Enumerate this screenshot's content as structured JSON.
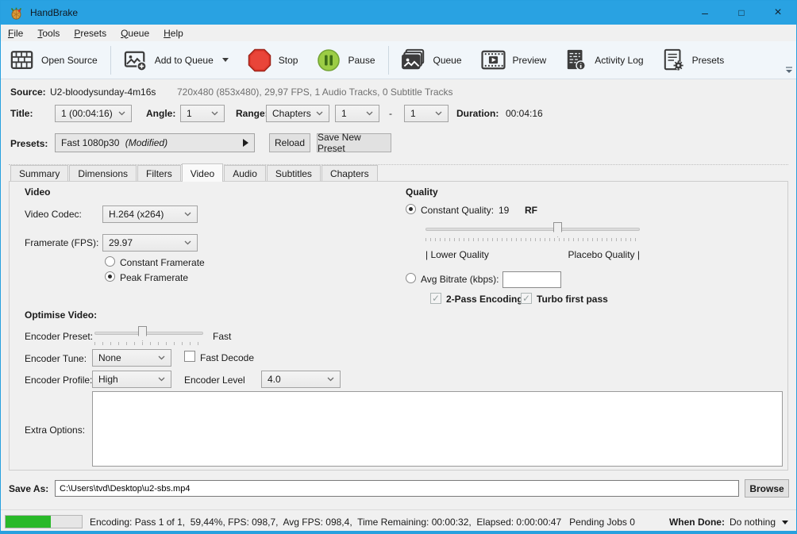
{
  "window": {
    "title": "HandBrake",
    "controls": {
      "minimize": "–",
      "maximize": "□",
      "close": "×"
    }
  },
  "menu": {
    "items": [
      {
        "label": "File"
      },
      {
        "label": "Tools"
      },
      {
        "label": "Presets"
      },
      {
        "label": "Queue"
      },
      {
        "label": "Help"
      }
    ]
  },
  "toolbar": {
    "open_source": "Open Source",
    "add_to_queue": "Add to Queue",
    "stop": "Stop",
    "pause": "Pause",
    "queue": "Queue",
    "preview": "Preview",
    "activity_log": "Activity Log",
    "presets": "Presets"
  },
  "source": {
    "label": "Source:",
    "filename": "U2-bloodysunday-4m16s",
    "details": "720x480 (853x480), 29,97 FPS, 1 Audio Tracks, 0 Subtitle Tracks"
  },
  "title_row": {
    "title_label": "Title:",
    "title_value": "1 (00:04:16)",
    "angle_label": "Angle:",
    "angle_value": "1",
    "range_label": "Range:",
    "range_type": "Chapters",
    "range_from": "1",
    "range_sep": "-",
    "range_to": "1",
    "duration_label": "Duration:",
    "duration_value": "00:04:16"
  },
  "presets_row": {
    "label": "Presets:",
    "preset_name": "Fast 1080p30",
    "preset_modified": "(Modified)",
    "reload": "Reload",
    "save_new_preset": "Save New Preset"
  },
  "tabs": {
    "items": [
      "Summary",
      "Dimensions",
      "Filters",
      "Video",
      "Audio",
      "Subtitles",
      "Chapters"
    ],
    "active": "Video"
  },
  "video_tab": {
    "video_section": {
      "heading": "Video",
      "codec_label": "Video Codec:",
      "codec_value": "H.264 (x264)",
      "framerate_label": "Framerate (FPS):",
      "framerate_value": "29.97",
      "constant_framerate_label": "Constant Framerate",
      "constant_framerate_selected": false,
      "peak_framerate_label": "Peak Framerate",
      "peak_framerate_selected": true
    },
    "optimise_section": {
      "heading": "Optimise Video:",
      "encoder_preset_label": "Encoder Preset:",
      "encoder_preset_value": "Fast",
      "encoder_tune_label": "Encoder Tune:",
      "encoder_tune_value": "None",
      "fast_decode_label": "Fast Decode",
      "fast_decode_checked": false,
      "encoder_profile_label": "Encoder Profile:",
      "encoder_profile_value": "High",
      "encoder_level_label": "Encoder Level",
      "encoder_level_value": "4.0"
    },
    "extra_options": {
      "label": "Extra Options:",
      "value": ""
    },
    "quality_section": {
      "heading": "Quality",
      "constant_quality_label": "Constant Quality:",
      "constant_quality_value": "19",
      "constant_quality_unit": "RF",
      "constant_quality_selected": true,
      "slider_min_label": "| Lower Quality",
      "slider_max_label": "Placebo Quality |",
      "avg_bitrate_label": "Avg Bitrate (kbps):",
      "avg_bitrate_value": "",
      "avg_bitrate_selected": false,
      "two_pass_label": "2-Pass Encoding",
      "two_pass_checked": true,
      "turbo_label": "Turbo first pass",
      "turbo_checked": true
    }
  },
  "save_as": {
    "label": "Save As:",
    "path": "C:\\Users\\tvd\\Desktop\\u2-sbs.mp4",
    "browse": "Browse"
  },
  "status_bar": {
    "progress_percent": 59.44,
    "status_text": "Encoding: Pass 1 of 1,  59,44%, FPS: 098,7,  Avg FPS: 098,4,  Time Remaining: 00:00:32,  Elapsed: 0:00:00:47   Pending Jobs 0",
    "when_done_label": "When Done:",
    "when_done_value": "Do nothing"
  }
}
